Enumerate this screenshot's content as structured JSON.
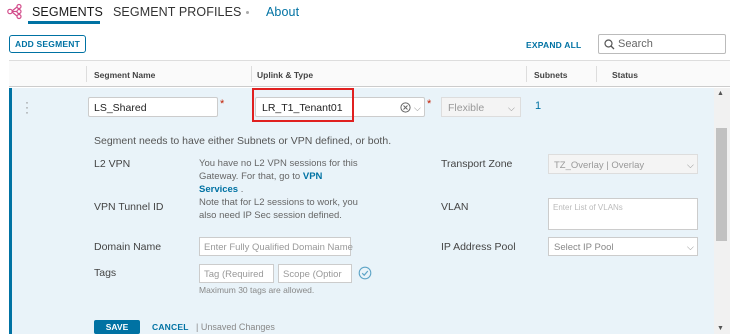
{
  "tabs": [
    {
      "label": "SEGMENTS",
      "active": true
    },
    {
      "label": "SEGMENT PROFILES",
      "active": false
    },
    {
      "label": "About",
      "active": false
    }
  ],
  "toolbar": {
    "add_segment": "ADD SEGMENT",
    "expand_all": "EXPAND ALL",
    "search_placeholder": "Search"
  },
  "table": {
    "columns": [
      "Segment Name",
      "Uplink & Type",
      "Subnets",
      "Status"
    ]
  },
  "segment": {
    "name": "LS_Shared",
    "uplink": "LR_T1_Tenant01",
    "type": "Flexible",
    "subnets_count": "1",
    "required_marker": "*",
    "message": "Segment needs to have either Subnets or VPN defined, or both.",
    "l2vpn_label": "L2 VPN",
    "l2vpn_info_1": "You have no L2 VPN sessions for this",
    "l2vpn_info_2a": "Gateway. For that, go to ",
    "l2vpn_info_link": "VPN Services",
    "l2vpn_info_2b": " .",
    "l2vpn_info_3": "Note that for L2 sessions to work, you",
    "l2vpn_info_4": "also need IP Sec session defined.",
    "vpn_tunnel_id_label": "VPN Tunnel ID",
    "transport_zone_label": "Transport Zone",
    "transport_zone_value": "TZ_Overlay | Overlay",
    "vlan_label": "VLAN",
    "vlan_placeholder": "Enter List of VLANs",
    "domain_name_label": "Domain Name",
    "domain_name_placeholder": "Enter Fully Qualified Domain Name",
    "ip_pool_label": "IP Address Pool",
    "ip_pool_placeholder": "Select IP Pool",
    "tags_label": "Tags",
    "tag_placeholder": "Tag (Required",
    "scope_placeholder": "Scope (Optior",
    "tags_hint": "Maximum 30 tags are allowed.",
    "save": "SAVE",
    "cancel": "CANCEL",
    "unsaved": "| Unsaved Changes"
  },
  "colors": {
    "accent": "#0072a3",
    "highlight_border": "#e02020",
    "row_background": "#e9f3f9"
  },
  "icons": [
    "segments-network-icon",
    "search-icon",
    "clear-icon",
    "chevron-down-icon",
    "check-circle-icon",
    "kebab-menu-icon"
  ]
}
